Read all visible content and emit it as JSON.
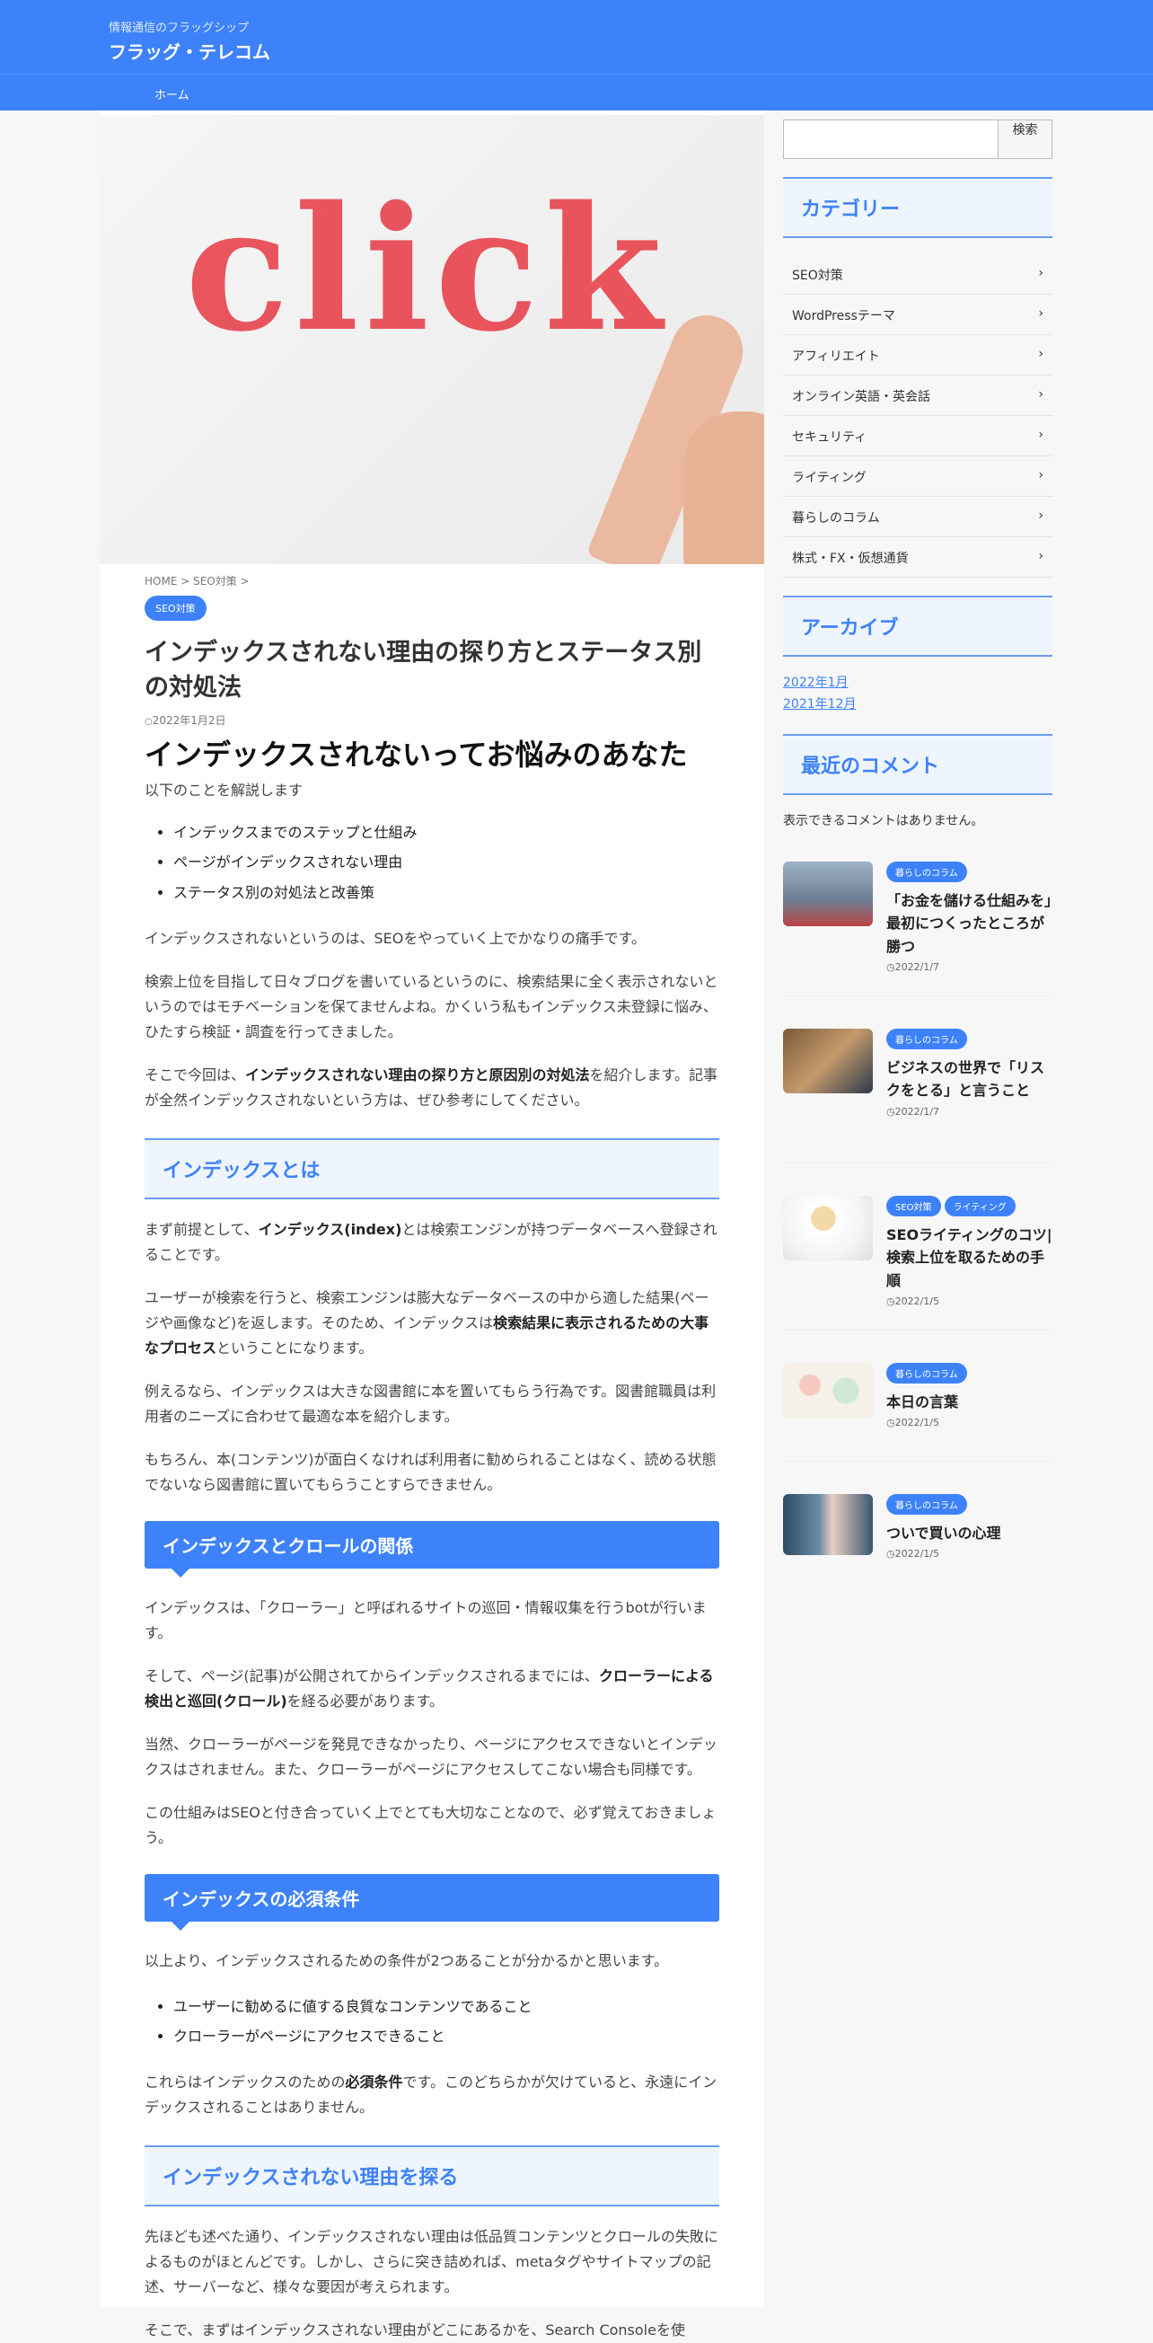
{
  "header": {
    "tagline": "情報通信のフラッグシップ",
    "title": "フラッグ・テレコム",
    "nav": [
      "ホーム"
    ]
  },
  "hero": {
    "text": "click"
  },
  "article": {
    "breadcrumb": "HOME > SEO対策 >",
    "category": "SEO対策",
    "title": "インデックスされない理由の探り方とステータス別の対処法",
    "date": "2022年1月2日",
    "lead_heading": "インデックスされないってお悩みのあなた",
    "lead_sub": "以下のことを解説します",
    "points": [
      "インデックスまでのステップと仕組み",
      "ページがインデックスされない理由",
      "ステータス別の対処法と改善策"
    ],
    "p1": "インデックスされないというのは、SEOをやっていく上でかなりの痛手です。",
    "p2": "検索上位を目指して日々ブログを書いているというのに、検索結果に全く表示されないというのではモチベーションを保てませんよね。かくいう私もインデックス未登録に悩み、ひたすら検証・調査を行ってきました。",
    "p3_a": "そこで今回は、",
    "p3_b": "インデックスされない理由の探り方と原因別の対処法",
    "p3_c": "を紹介します。記事が全然インデックスされないという方は、ぜひ参考にしてください。",
    "h2_1": "インデックスとは",
    "p4_a": "まず前提として、",
    "p4_b": "インデックス(index)",
    "p4_c": "とは検索エンジンが持つデータベースへ登録されることです。",
    "p5_a": "ユーザーが検索を行うと、検索エンジンは膨大なデータベースの中から適した結果(ページや画像など)を返します。そのため、インデックスは",
    "p5_b": "検索結果に表示されるための大事なプロセス",
    "p5_c": "ということになります。",
    "p6": "例えるなら、インデックスは大きな図書館に本を置いてもらう行為です。図書館職員は利用者のニーズに合わせて最適な本を紹介します。",
    "p7": "もちろん、本(コンテンツ)が面白くなければ利用者に勧められることはなく、読める状態でないなら図書館に置いてもらうことすらできません。",
    "h3_1": "インデックスとクロールの関係",
    "p8": "インデックスは、「クローラー」と呼ばれるサイトの巡回・情報収集を行うbotが行います。",
    "p9_a": "そして、ページ(記事)が公開されてからインデックスされるまでには、",
    "p9_b": "クローラーによる検出と巡回(クロール)",
    "p9_c": "を経る必要があります。",
    "p10": "当然、クローラーがページを発見できなかったり、ページにアクセスできないとインデックスはされません。また、クローラーがページにアクセスしてこない場合も同様です。",
    "p11": "この仕組みはSEOと付き合っていく上でとても大切なことなので、必ず覚えておきましょう。",
    "h3_2": "インデックスの必須条件",
    "p12": "以上より、インデックスされるための条件が2つあることが分かるかと思います。",
    "points2": [
      "ユーザーに勧めるに値する良質なコンテンツであること",
      "クローラーがページにアクセスできること"
    ],
    "p13_a": "これらはインデックスのための",
    "p13_b": "必須条件",
    "p13_c": "です。このどちらかが欠けていると、永遠にインデックスされることはありません。",
    "h2_2": "インデックスされない理由を探る",
    "p14": "先ほども述べた通り、インデックスされない理由は低品質コンテンツとクロールの失敗によるものがほとんどです。しかし、さらに突き詰めれば、metaタグやサイトマップの記述、サーバーなど、様々な要因が考えられます。",
    "p15": "そこで、まずはインデックスされない理由がどこにあるかを、Search Consoleを使"
  },
  "sidebar": {
    "search_button": "検索",
    "categories_title": "カテゴリー",
    "categories": [
      "SEO対策",
      "WordPressテーマ",
      "アフィリエイト",
      "オンライン英語・英会話",
      "セキュリティ",
      "ライティング",
      "暮らしのコラム",
      "株式・FX・仮想通貨"
    ],
    "chevron": "›",
    "archive_title": "アーカイブ",
    "archives": [
      "2022年1月",
      "2021年12月"
    ],
    "comments_title": "最近のコメント",
    "no_comments": "表示できるコメントはありません。",
    "recent": [
      {
        "badges": [
          "暮らしのコラム"
        ],
        "title": "「お金を儲ける仕組みを」最初につくったところが勝つ",
        "date": "2022/1/7"
      },
      {
        "badges": [
          "暮らしのコラム"
        ],
        "title": "ビジネスの世界で「リスクをとる」と言うこと",
        "date": "2022/1/7"
      },
      {
        "badges": [
          "SEO対策",
          "ライティング"
        ],
        "title": "SEOライティングのコツ|検索上位を取るための手順",
        "date": "2022/1/5"
      },
      {
        "badges": [
          "暮らしのコラム"
        ],
        "title": "本日の言葉",
        "date": "2022/1/5"
      },
      {
        "badges": [
          "暮らしのコラム"
        ],
        "title": "ついで買いの心理",
        "date": "2022/1/5"
      }
    ]
  },
  "colors": {
    "accent": "#3d82fb",
    "light_bg": "#eef5ff"
  }
}
